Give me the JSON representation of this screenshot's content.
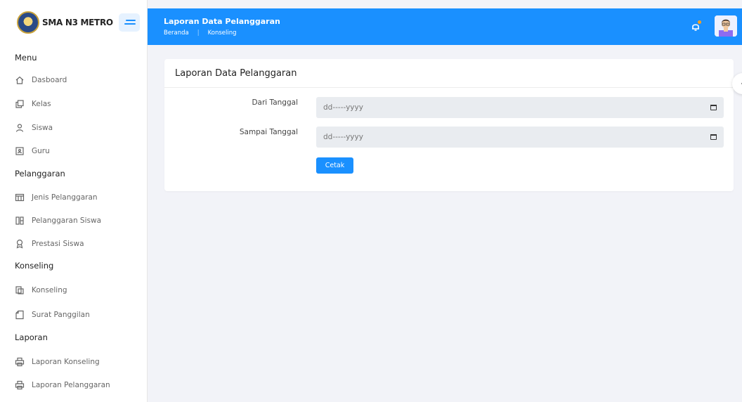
{
  "brand": {
    "name": "SMA N3 METRO"
  },
  "topbar": {
    "title": "Laporan Data Pelanggaran",
    "breadcrumb": [
      "Beranda",
      "Konseling"
    ]
  },
  "sidebar": {
    "sections": [
      {
        "label": "Menu",
        "items": [
          {
            "label": "Dasboard",
            "icon": "home-icon"
          },
          {
            "label": "Kelas",
            "icon": "copy-icon"
          },
          {
            "label": "Siswa",
            "icon": "user-icon"
          },
          {
            "label": "Guru",
            "icon": "id-card-icon"
          }
        ]
      },
      {
        "label": "Pelanggaran",
        "items": [
          {
            "label": "Jenis Pelanggaran",
            "icon": "table-icon"
          },
          {
            "label": "Pelanggaran Siswa",
            "icon": "columns-icon"
          },
          {
            "label": "Prestasi Siswa",
            "icon": "award-icon"
          }
        ]
      },
      {
        "label": "Konseling",
        "items": [
          {
            "label": "Konseling",
            "icon": "files-icon"
          },
          {
            "label": "Surat Panggilan",
            "icon": "file-icon"
          }
        ]
      },
      {
        "label": "Laporan",
        "items": [
          {
            "label": "Laporan Konseling",
            "icon": "printer-icon"
          },
          {
            "label": "Laporan Pelanggaran",
            "icon": "printer-icon"
          }
        ]
      }
    ]
  },
  "card": {
    "title": "Laporan Data Pelanggaran",
    "from_label": "Dari Tanggal",
    "from_placeholder": "dd-----yyyy",
    "to_label": "Sampai Tanggal",
    "to_placeholder": "dd-----yyyy",
    "submit_label": "Cetak"
  },
  "colors": {
    "primary": "#1a90ff",
    "background": "#f2f3f8",
    "notification": "#ff9f1a"
  }
}
